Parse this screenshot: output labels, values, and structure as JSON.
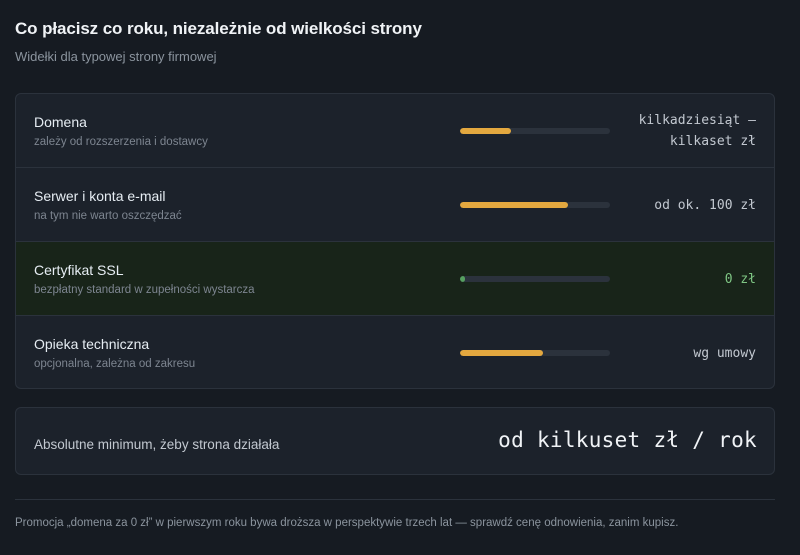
{
  "header": {
    "title": "Co płacisz co roku, niezależnie od wielkości strony",
    "subtitle": "Widełki dla typowej strony firmowej"
  },
  "costs": {
    "items": [
      {
        "name": "Domena",
        "description": "zależy od rozszerzenia i dostawcy",
        "price_line1": "kilkadziesiąt –",
        "price_line2": "kilkaset zł",
        "level": 0.34,
        "highlight": false
      },
      {
        "name": "Serwer i konta e-mail",
        "description": "na tym nie warto oszczędzać",
        "price_line1": "od ok. 100 zł",
        "price_line2": "",
        "level": 0.72,
        "highlight": false
      },
      {
        "name": "Certyfikat SSL",
        "description": "bezpłatny standard w zupełności wystarcza",
        "price_line1": "0 zł",
        "price_line2": "",
        "level": 0.03,
        "highlight": true
      },
      {
        "name": "Opieka techniczna",
        "description": "opcjonalna, zależna od zakresu",
        "price_line1": "wg umowy",
        "price_line2": "",
        "level": 0.55,
        "highlight": false
      }
    ]
  },
  "summary": {
    "label": "Absolutne minimum, żeby strona działała",
    "value": "od kilkuset zł / rok"
  },
  "footnote": "Promocja „domena za 0 zł” w pierwszym roku bywa droższa w perspektywie trzech lat — sprawdź cenę odnowienia, zanim kupisz.",
  "colors": {
    "bar_accent": "#e3a83f",
    "bar_positive": "#56a060",
    "positive_text": "#7ec583"
  }
}
